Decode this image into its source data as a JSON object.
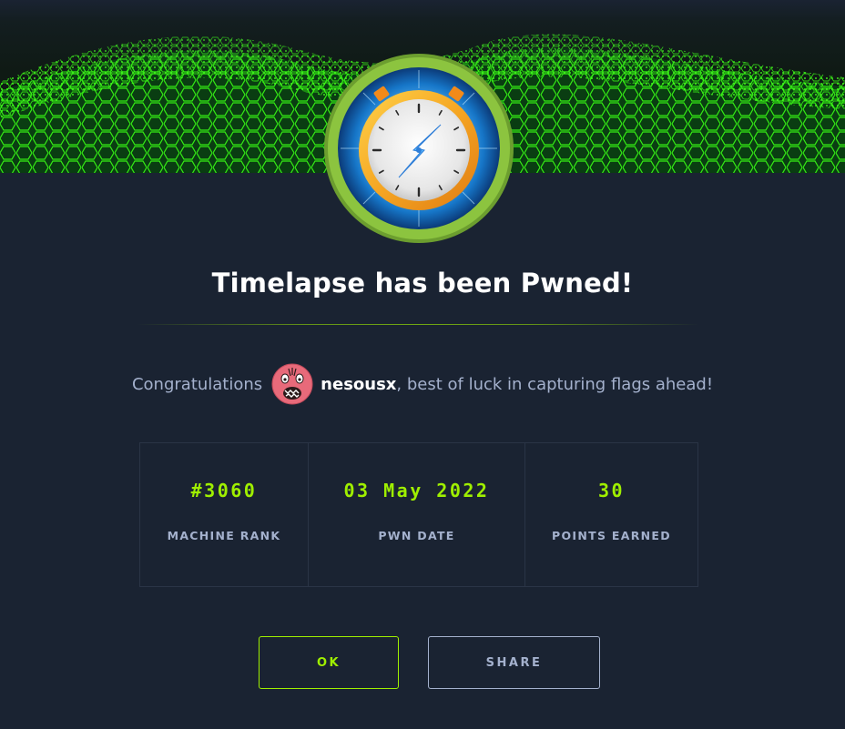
{
  "modal": {
    "machine_name": "Timelapse",
    "title": "Timelapse has been Pwned!",
    "congrats_prefix": "Congratulations",
    "username": "nesousx",
    "congrats_suffix": ", best of luck in capturing flags ahead!"
  },
  "stats": [
    {
      "value": "#3060",
      "label": "MACHINE RANK"
    },
    {
      "value": "03 May 2022",
      "label": "PWN DATE"
    },
    {
      "value": "30",
      "label": "POINTS EARNED"
    }
  ],
  "buttons": {
    "ok_label": "OK",
    "share_label": "SHARE"
  },
  "colors": {
    "background": "#1a2332",
    "accent": "#9fef00",
    "muted_text": "#a4b1cd",
    "title_text": "#ffffff"
  },
  "icons": {
    "badge": "stopwatch-badge-icon",
    "avatar": "user-avatar-icon",
    "banner": "green-hex-grid-banner"
  }
}
